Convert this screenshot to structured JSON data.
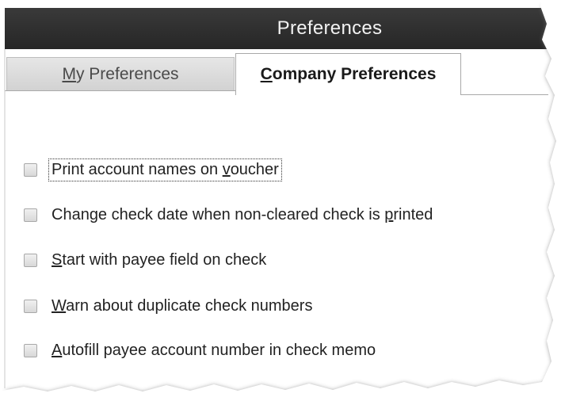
{
  "window": {
    "title": "Preferences"
  },
  "tabs": [
    {
      "pre": "",
      "mnemonic": "M",
      "post": "y Preferences",
      "selected": false
    },
    {
      "pre": "",
      "mnemonic": "C",
      "post": "ompany Preferences",
      "selected": true
    }
  ],
  "options": [
    {
      "pre": "Print account names on ",
      "mnemonic": "v",
      "post": "oucher",
      "checked": false,
      "focused": true
    },
    {
      "pre": "Change check date when non-cleared check is ",
      "mnemonic": "p",
      "post": "rinted",
      "checked": false,
      "focused": false
    },
    {
      "pre": "",
      "mnemonic": "S",
      "post": "tart with payee field on check",
      "checked": false,
      "focused": false
    },
    {
      "pre": "",
      "mnemonic": "W",
      "post": "arn about duplicate check numbers",
      "checked": false,
      "focused": false
    },
    {
      "pre": "",
      "mnemonic": "A",
      "post": "utofill payee account number in check memo",
      "checked": false,
      "focused": false
    }
  ],
  "colors": {
    "titlebar": "#2e2e2e",
    "tab_inactive": "#dcdcdc",
    "checkbox": "#e2e2e2"
  }
}
